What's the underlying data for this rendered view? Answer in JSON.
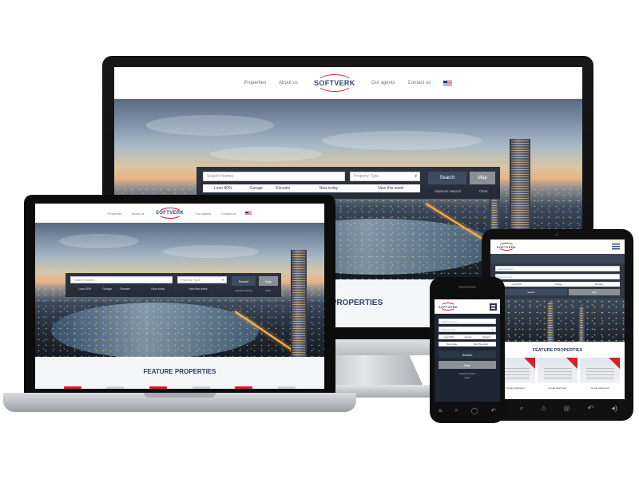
{
  "site": {
    "brand": "SOFTVERK",
    "nav_left": [
      "Properties",
      "About us"
    ],
    "nav_right": [
      "Our agents",
      "Contact us"
    ],
    "search_placeholder": "Search Homes",
    "property_type_placeholder": "Property Type",
    "filters_row1": [
      "Loan 80%",
      "Garage",
      "Elevator"
    ],
    "filters_row2": [
      "New today",
      "New this week"
    ],
    "search_button": "Search",
    "map_button": "Map",
    "advance_search": "Advance Search",
    "clear": "Clear",
    "feature_heading": "FEATURE PROPERTIES",
    "monitor_feature_partial": "RE PROPERTIES",
    "property_cards": [
      "Condo Apartment",
      "Condo Apartment",
      "Condo Apartment"
    ]
  },
  "colors": {
    "brand_navy": "#2f4a7a",
    "brand_red": "#d4202a",
    "search_panel": "#1e2634",
    "search_button": "#3c4c62",
    "map_button": "#8a8f98"
  },
  "icons": [
    "us-flag-icon",
    "back-icon",
    "home-icon",
    "recent-apps-icon",
    "menu-icon",
    "search-icon",
    "volume-icon",
    "hamburger-icon"
  ]
}
